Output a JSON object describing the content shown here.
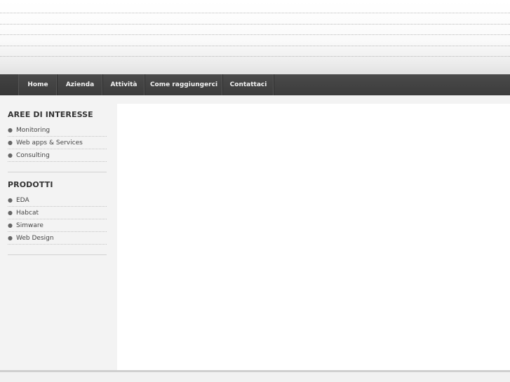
{
  "nav": {
    "items": [
      "Home",
      "Azienda",
      "Attività",
      "Come raggiungerci",
      "Contattaci"
    ]
  },
  "sidebar": {
    "aree_title": "AREE DI INTERESSE",
    "aree_items": [
      "Monitoring",
      "Web apps & Services",
      "Consulting"
    ],
    "prodotti_title": "PRODOTTI",
    "prodotti_items": [
      "EDA",
      "Habcat",
      "Simware",
      "Web Design"
    ]
  },
  "colors": {
    "nav_bg": "#404040",
    "sidebar_bg": "#f3f3f3",
    "footer_bg": "#f1f1f1"
  },
  "icons": {
    "bullet": "bullet-icon"
  }
}
